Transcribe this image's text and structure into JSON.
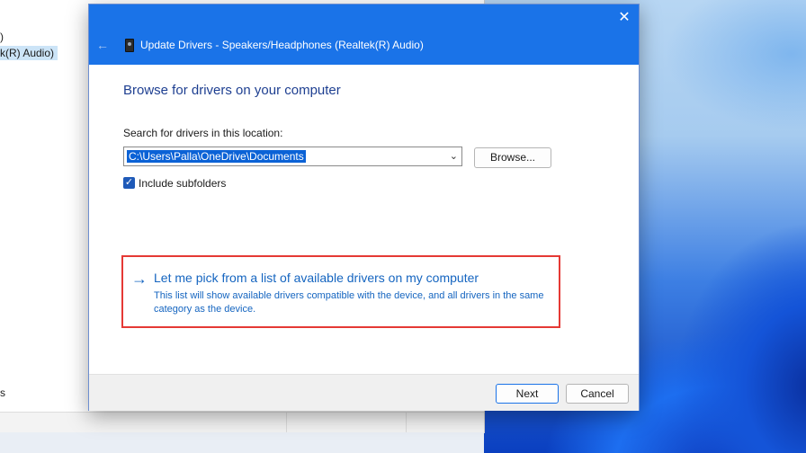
{
  "background_window": {
    "fragments": [
      ")",
      "k(R) Audio)",
      "s"
    ]
  },
  "dialog": {
    "title": "Update Drivers - Speakers/Headphones (Realtek(R) Audio)",
    "close_icon": "close-icon",
    "back_icon": "back-arrow-icon",
    "device_icon": "speaker-device-icon",
    "heading": "Browse for drivers on your computer",
    "search_label": "Search for drivers in this location:",
    "path_value": "C:\\Users\\Palla\\OneDrive\\Documents",
    "browse_label": "Browse...",
    "include_subfolders": {
      "label": "Include subfolders",
      "checked": true
    },
    "pick_option": {
      "title": "Let me pick from a list of available drivers on my computer",
      "description": "This list will show available drivers compatible with the device, and all drivers in the same category as the device."
    },
    "next_label": "Next",
    "cancel_label": "Cancel"
  },
  "colors": {
    "titlebar": "#1a73e8",
    "heading": "#1e3f91",
    "link": "#1565c0",
    "highlight_border": "#e53935"
  }
}
